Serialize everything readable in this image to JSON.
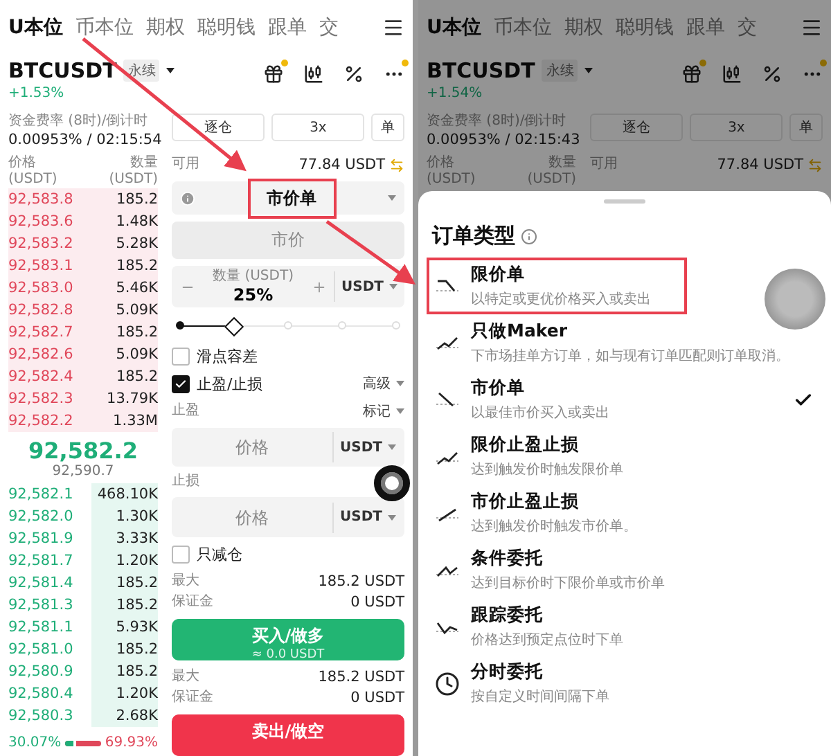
{
  "left": {
    "tabs": [
      {
        "label": "U本位",
        "selected": true
      },
      {
        "label": "币本位",
        "selected": false
      },
      {
        "label": "期权",
        "selected": false
      },
      {
        "label": "聪明钱",
        "selected": false
      },
      {
        "label": "跟单",
        "selected": false
      },
      {
        "label": "交",
        "selected": false
      }
    ],
    "symbol": "BTCUSDT",
    "contract": "永续",
    "change": "+1.53%",
    "funding_label": "资金费率 (8时)/倒计时",
    "funding_value": "0.00953% / 02:15:54",
    "price_header": "价格",
    "price_unit": "(USDT)",
    "qty_header": "数量",
    "qty_unit": "(USDT)",
    "asks": [
      {
        "price": "92,583.8",
        "qty": "185.2"
      },
      {
        "price": "92,583.6",
        "qty": "1.48K"
      },
      {
        "price": "92,583.2",
        "qty": "5.28K"
      },
      {
        "price": "92,583.1",
        "qty": "185.2"
      },
      {
        "price": "92,583.0",
        "qty": "5.46K"
      },
      {
        "price": "92,582.8",
        "qty": "5.09K"
      },
      {
        "price": "92,582.7",
        "qty": "185.2"
      },
      {
        "price": "92,582.6",
        "qty": "5.09K"
      },
      {
        "price": "92,582.4",
        "qty": "185.2"
      },
      {
        "price": "92,582.3",
        "qty": "13.79K"
      },
      {
        "price": "92,582.2",
        "qty": "1.33M"
      }
    ],
    "last_price": "92,582.2",
    "mark_price": "92,590.7",
    "bids": [
      {
        "price": "92,582.1",
        "qty": "468.10K"
      },
      {
        "price": "92,582.0",
        "qty": "1.30K"
      },
      {
        "price": "92,581.9",
        "qty": "3.33K"
      },
      {
        "price": "92,581.7",
        "qty": "1.20K"
      },
      {
        "price": "92,581.4",
        "qty": "185.2"
      },
      {
        "price": "92,581.3",
        "qty": "185.2"
      },
      {
        "price": "92,581.1",
        "qty": "5.93K"
      },
      {
        "price": "92,581.0",
        "qty": "185.2"
      },
      {
        "price": "92,580.9",
        "qty": "185.2"
      },
      {
        "price": "92,580.4",
        "qty": "1.20K"
      },
      {
        "price": "92,580.3",
        "qty": "2.68K"
      }
    ],
    "ratio": {
      "buy": "30.07%",
      "sell": "69.93%",
      "level": 0.3007
    },
    "form": {
      "margin_mode": "逐仓",
      "leverage": "3x",
      "position_mode": "单",
      "available_label": "可用",
      "available_value": "77.84 USDT",
      "order_type": {
        "value": "市价单",
        "highlighted": true
      },
      "price_field": {
        "value": "市价",
        "disabled": true
      },
      "quantity": {
        "label": "数量 (USDT)",
        "value": "25%",
        "unit": "USDT"
      },
      "slider": {
        "level": 0.25
      },
      "slippage": {
        "label": "滑点容差",
        "checked": false
      },
      "tpsl": {
        "label": "止盈/止损",
        "checked": true,
        "mode": "高级"
      },
      "take_profit": {
        "label": "止盈",
        "trigger": "标记",
        "placeholder": "价格",
        "unit": "USDT"
      },
      "stop_loss": {
        "label": "止损",
        "placeholder": "价格",
        "unit": "USDT"
      },
      "reduce_only": {
        "label": "只减仓",
        "checked": false
      },
      "buy_summary": [
        {
          "label": "最大",
          "value": "185.2 USDT"
        },
        {
          "label": "保证金",
          "value": "0 USDT"
        }
      ],
      "buy_button": {
        "label": "买入/做多",
        "sub": "≈ 0.0 USDT"
      },
      "sell_summary": [
        {
          "label": "最大",
          "value": "185.2 USDT"
        },
        {
          "label": "保证金",
          "value": "0 USDT"
        }
      ],
      "sell_button": {
        "label": "卖出/做空"
      }
    }
  },
  "right": {
    "dimmed": true,
    "tabs": [
      {
        "label": "U本位",
        "selected": true
      },
      {
        "label": "币本位",
        "selected": false
      },
      {
        "label": "期权",
        "selected": false
      },
      {
        "label": "聪明钱",
        "selected": false
      },
      {
        "label": "跟单",
        "selected": false
      },
      {
        "label": "交",
        "selected": false
      }
    ],
    "symbol": "BTCUSDT",
    "contract": "永续",
    "change": "+1.54%",
    "funding_label": "资金费率 (8时)/倒计时",
    "funding_value": "0.00953% / 02:15:43",
    "price_header": "价格",
    "price_unit": "(USDT)",
    "qty_header": "数量",
    "qty_unit": "(USDT)",
    "margin_mode": "逐仓",
    "leverage": "3x",
    "position_mode": "单",
    "available_label": "可用",
    "available_value": "77.84 USDT",
    "sheet": {
      "title": "订单类型",
      "items": [
        {
          "kind": "limit",
          "title": "限价单",
          "desc": "以特定或更优价格买入或卖出",
          "selected": false,
          "highlighted": true
        },
        {
          "kind": "maker",
          "title": "只做Maker",
          "desc": "下市场挂单方订单，如与现有订单匹配则订单取消。",
          "selected": false,
          "highlighted": false
        },
        {
          "kind": "market",
          "title": "市价单",
          "desc": "以最佳市价买入或卖出",
          "selected": true,
          "highlighted": false
        },
        {
          "kind": "tpsl_limit",
          "title": "限价止盈止损",
          "desc": "达到触发价时触发限价单",
          "selected": false,
          "highlighted": false
        },
        {
          "kind": "tpsl_market",
          "title": "市价止盈止损",
          "desc": "达到触发价时触发市价单。",
          "selected": false,
          "highlighted": false
        },
        {
          "kind": "conditional",
          "title": "条件委托",
          "desc": "达到目标价时下限价单或市价单",
          "selected": false,
          "highlighted": false
        },
        {
          "kind": "trailing",
          "title": "跟踪委托",
          "desc": "价格达到预定点位时下单",
          "selected": false,
          "highlighted": false
        },
        {
          "kind": "twap",
          "title": "分时委托",
          "desc": "按自定义时间间隔下单",
          "selected": false,
          "highlighted": false
        }
      ]
    }
  }
}
